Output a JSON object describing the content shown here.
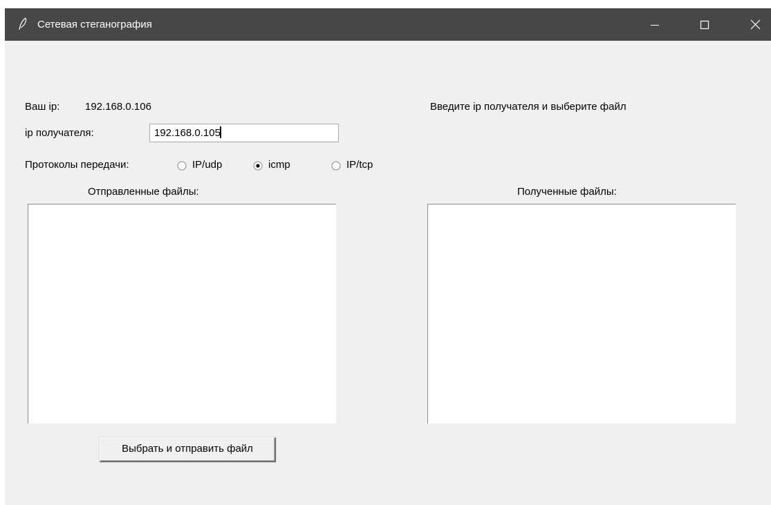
{
  "window": {
    "title": "Сетевая стеганография",
    "controls": {
      "minimize": "minimize-icon",
      "maximize": "maximize-icon",
      "close": "close-icon"
    }
  },
  "form": {
    "your_ip_label": "Ваш ip:",
    "your_ip_value": "192.168.0.106",
    "status_text": "Введите ip получателя и выберите файл",
    "recipient_label": "ip получателя:",
    "recipient_value": "192.168.0.105",
    "protocols_label": "Протоколы передачи:",
    "protocols": [
      {
        "label": "IP/udp",
        "selected": false
      },
      {
        "label": "icmp",
        "selected": true
      },
      {
        "label": "IP/tcp",
        "selected": false
      }
    ]
  },
  "lists": {
    "sent_label": "Отправленные файлы:",
    "sent_items": [],
    "received_label": "Полученные файлы:",
    "received_items": []
  },
  "actions": {
    "send_button": "Выбрать и отправить файл"
  },
  "colors": {
    "titlebar": "#474747",
    "window_bg": "#f0f0f0",
    "list_bg": "#ffffff"
  }
}
